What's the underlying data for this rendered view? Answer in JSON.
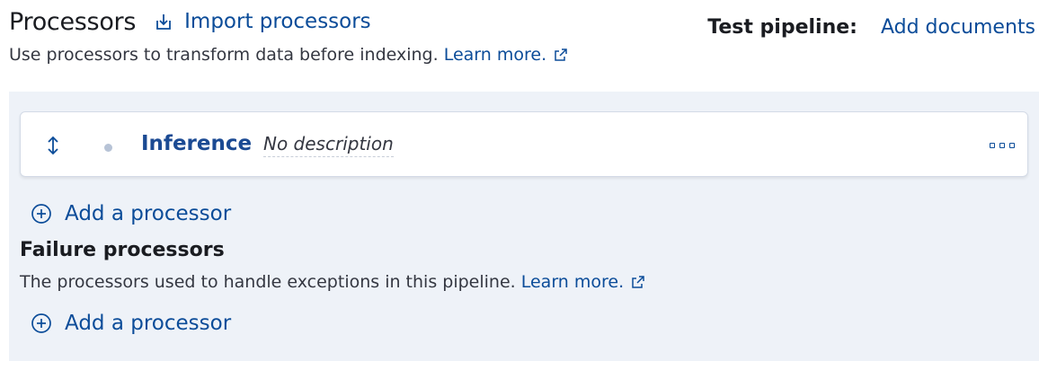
{
  "header": {
    "title": "Processors",
    "import_label": "Import processors",
    "subtitle": "Use processors to transform data before indexing.",
    "learn_more": "Learn more."
  },
  "test_pipeline": {
    "label": "Test pipeline:",
    "action": "Add documents"
  },
  "processors": [
    {
      "name": "Inference",
      "description": "No description",
      "status_icon": "dot-icon"
    }
  ],
  "add_processor_label": "Add a processor",
  "failure": {
    "title": "Failure processors",
    "description": "The processors used to handle exceptions in this pipeline.",
    "learn_more": "Learn more.",
    "add_processor_label": "Add a processor"
  },
  "colors": {
    "link": "#0b4c99",
    "panel_bg": "#eef2f8",
    "text": "#1a1c21"
  },
  "icons": {
    "import": "import-icon",
    "external": "external-link-icon",
    "drag": "drag-vertical-icon",
    "more": "more-actions-icon",
    "add": "plus-circle-icon"
  }
}
